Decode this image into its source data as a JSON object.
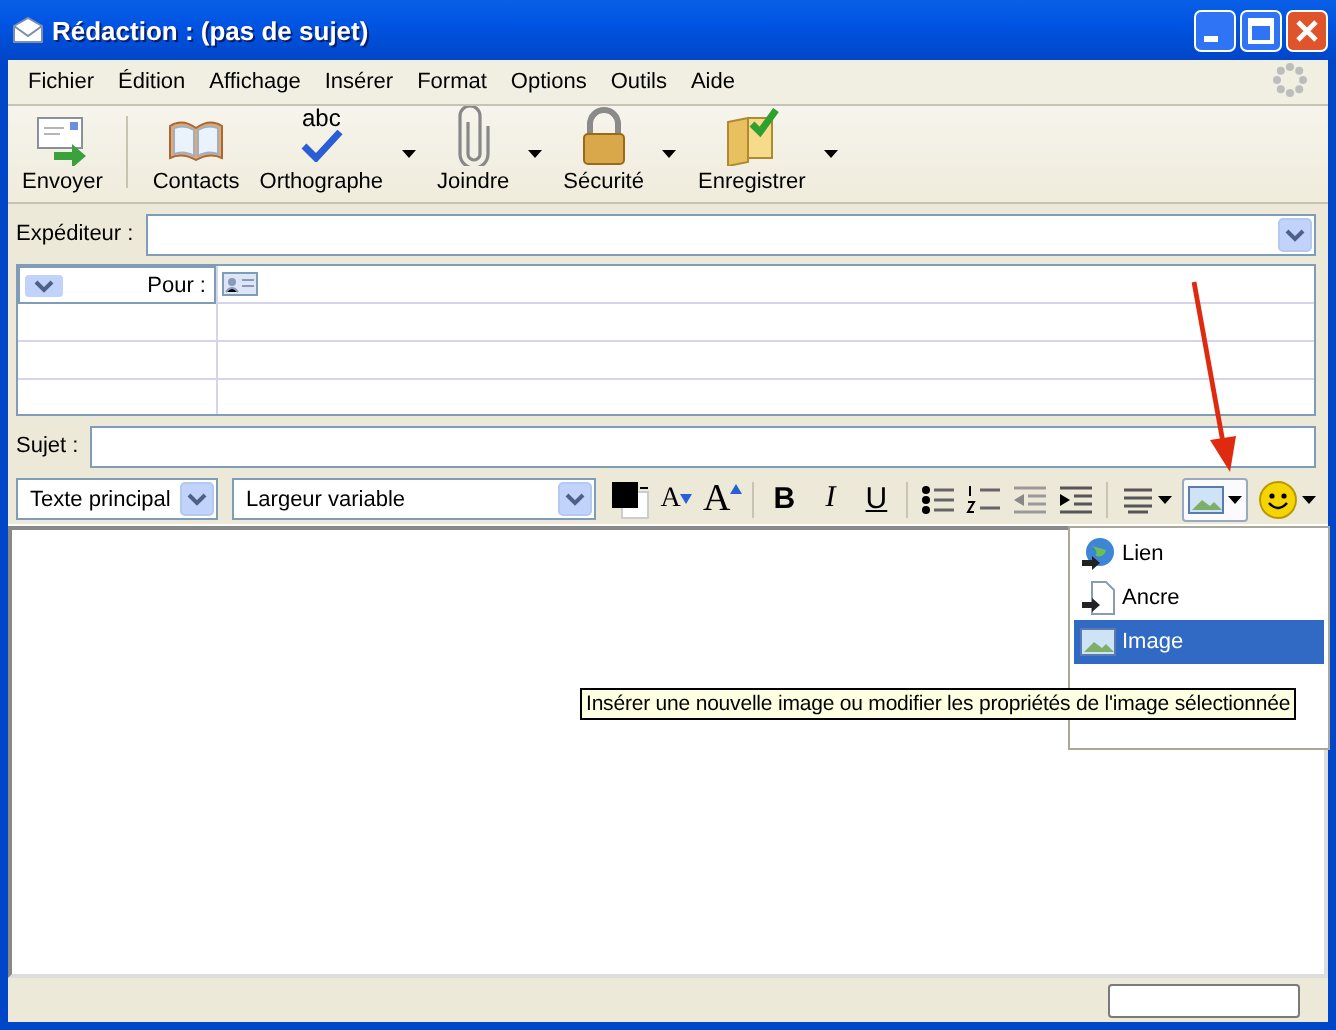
{
  "window": {
    "title": "Rédaction : (pas de sujet)"
  },
  "menu_bar": [
    {
      "label": "Fichier"
    },
    {
      "label": "Édition"
    },
    {
      "label": "Affichage"
    },
    {
      "label": "Insérer"
    },
    {
      "label": "Format"
    },
    {
      "label": "Options"
    },
    {
      "label": "Outils"
    },
    {
      "label": "Aide"
    }
  ],
  "toolbar": [
    {
      "label": "Envoyer",
      "kind": "send",
      "dropdown": false
    },
    {
      "label": "Contacts",
      "kind": "contacts",
      "dropdown": false
    },
    {
      "label": "Orthographe",
      "kind": "spell",
      "icon_text": "abc",
      "dropdown": true
    },
    {
      "label": "Joindre",
      "kind": "attach",
      "dropdown": true
    },
    {
      "label": "Sécurité",
      "kind": "security",
      "dropdown": true
    },
    {
      "label": "Enregistrer",
      "kind": "save",
      "dropdown": true
    }
  ],
  "sender": {
    "label": "Expéditeur :"
  },
  "recipients": [
    {
      "type": "Pour :"
    }
  ],
  "subject": {
    "label": "Sujet :"
  },
  "format_bar": {
    "paragraph_style": "Texte principal",
    "font": "Largeur variable",
    "smaller": "A",
    "larger": "A",
    "bold": "B",
    "italic": "I",
    "underline": "U",
    "insert_expanded": true
  },
  "insert_menu": [
    {
      "label": "Lien",
      "kind": "link",
      "selected": false
    },
    {
      "label": "Ancre",
      "kind": "anchor",
      "selected": false
    },
    {
      "label": "Image",
      "kind": "image",
      "selected": true
    }
  ],
  "tooltip": "Insérer une nouvelle image ou modifier les propriétés de l'image sélectionnée"
}
